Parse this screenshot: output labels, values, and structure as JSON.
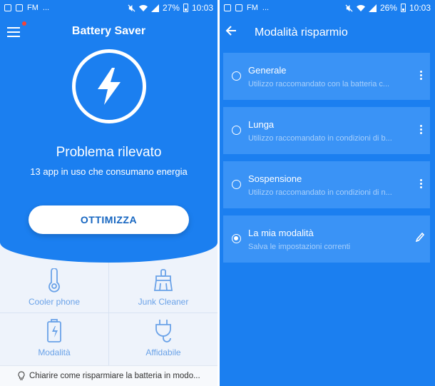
{
  "colors": {
    "primary_blue": "#1b7ff0",
    "card_blue": "#3a93f6",
    "accent_text": "#6aa2e8",
    "notification_dot": "#f44336"
  },
  "left": {
    "status": {
      "fm": "FM",
      "dots": "...",
      "battery": "27%",
      "time": "10:03"
    },
    "app_title": "Battery Saver",
    "hero_icon": "lightning-bolt-icon",
    "problem_title": "Problema rilevato",
    "problem_subtitle": "13 app in uso che consumano energia",
    "optimize_label": "OTTIMIZZA",
    "features": [
      {
        "label": "Cooler phone",
        "icon": "thermometer-icon"
      },
      {
        "label": "Junk Cleaner",
        "icon": "broom-icon"
      },
      {
        "label": "Modalità",
        "icon": "battery-icon"
      },
      {
        "label": "Affidabile",
        "icon": "plug-icon"
      }
    ],
    "tip": "Chiarire come risparmiare la batteria in modo..."
  },
  "right": {
    "status": {
      "fm": "FM",
      "dots": "...",
      "battery": "26%",
      "time": "10:03"
    },
    "title": "Modalità risparmio",
    "modes": [
      {
        "title": "Generale",
        "subtitle": "Utilizzo raccomandato con la batteria c...",
        "selected": false,
        "action": "more"
      },
      {
        "title": "Lunga",
        "subtitle": "Utilizzo raccomandato in condizioni di b...",
        "selected": false,
        "action": "more"
      },
      {
        "title": "Sospensione",
        "subtitle": "Utilizzo raccomandato in condizioni di n...",
        "selected": false,
        "action": "more"
      },
      {
        "title": "La mia modalità",
        "subtitle": "Salva le impostazioni correnti",
        "selected": true,
        "action": "edit"
      }
    ]
  }
}
